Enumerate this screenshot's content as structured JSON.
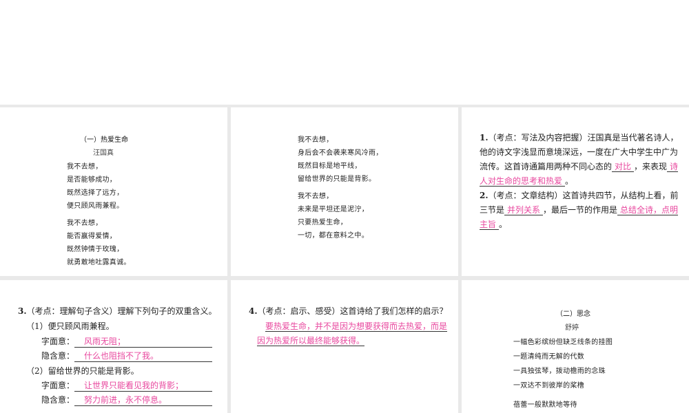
{
  "poem1": {
    "title": "（一）热爱生命",
    "author": "汪国真",
    "stanza1": [
      "我不去想，",
      "是否能够成功，",
      "既然选择了远方，",
      "便只顾风雨兼程。"
    ],
    "stanza2": [
      "我不去想，",
      "能否赢得爱情，",
      "既然钟情于玫瑰，",
      "就勇敢地吐露真诚。"
    ],
    "stanza3": [
      "我不去想，",
      "身后会不会袭来寒风冷雨，",
      "既然目标是地平线，",
      "留给世界的只能是背影。"
    ],
    "stanza4": [
      "我不去想，",
      "未来是平坦还是泥泞，",
      "只要热爱生命，",
      "一切，都在意料之中。"
    ]
  },
  "q1": {
    "num": "1.",
    "prefix": "（考点：写法及内容把握）汪国真是当代著名诗人，他的诗文字浅显而意境深远，一度在广大中学生中广为流传。这首诗通篇用两种不同心态的",
    "ans1": "对比",
    "middle": "，来表现",
    "ans2": "诗人对生命的思考和热爱",
    "suffix": "。"
  },
  "q2": {
    "num": "2.",
    "prefix": "（考点：文章结构）这首诗共四节，从结构上看，前三节是",
    "ans1": "并列关系",
    "middle": "，最后一节的作用是",
    "ans2": "总结全诗，点明主旨",
    "suffix": "。"
  },
  "q3": {
    "num": "3.",
    "stem": "（考点：理解句子含义）理解下列句子的双重含义。",
    "sub1": "（1）便只顾风雨兼程。",
    "sub2": "（2）留给世界的只能是背影。",
    "literal_label": "字面意：",
    "implied_label": "隐含意：",
    "a1_literal": "风雨无阻；",
    "a1_implied": "什么也阻挡不了我。",
    "a2_literal": "让世界只能看见我的背影；",
    "a2_implied": "努力前进，永不停息。"
  },
  "q4": {
    "num": "4.",
    "stem": "（考点：启示、感受）这首诗给了我们怎样的启示？",
    "answer": "要热爱生命，并不是因为想要获得而去热爱，而是因为热爱所以最终能够获得。"
  },
  "poem2": {
    "title": "（二）思念",
    "author": "舒婷",
    "stanza1": [
      "一幅色彩缤纷但缺乏线条的挂图",
      "一题清纯而无解的代数",
      "一具独弦琴，拨动檐雨的念珠",
      "一双达不到彼岸的桨橹"
    ],
    "stanza2": [
      "蓓蕾一般默默地等待"
    ]
  },
  "colors": {
    "answer": "#e8479e",
    "background": "#e9e9e9"
  }
}
